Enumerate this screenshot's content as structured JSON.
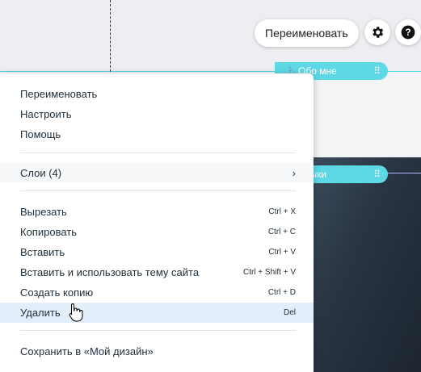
{
  "toolbar": {
    "rename_label": "Переименовать",
    "settings_icon": "gear-icon",
    "help_icon": "help-icon"
  },
  "sections": {
    "about_tag": "Обо мне",
    "music_tag_partial": "зыки"
  },
  "menu": {
    "group1": [
      "Переименовать",
      "Настроить",
      "Помощь"
    ],
    "layers_label": "Слои (4)",
    "edit_items": [
      {
        "label": "Вырезать",
        "shortcut": "Ctrl + X"
      },
      {
        "label": "Копировать",
        "shortcut": "Ctrl + C"
      },
      {
        "label": "Вставить",
        "shortcut": "Ctrl + V"
      },
      {
        "label": "Вставить и использовать тему сайта",
        "shortcut": "Ctrl + Shift + V"
      },
      {
        "label": "Создать копию",
        "shortcut": "Ctrl + D"
      },
      {
        "label": "Удалить",
        "shortcut": "Del"
      }
    ],
    "save_label": "Сохранить в «Мой дизайн»"
  },
  "colors": {
    "accent": "#5ed8e5",
    "hover_bg": "#e3eefb"
  }
}
